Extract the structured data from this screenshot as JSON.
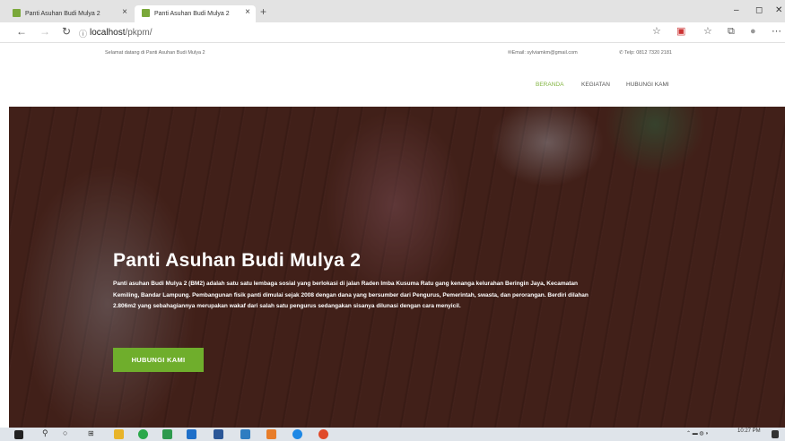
{
  "browser": {
    "tabs": [
      {
        "label": "Panti Asuhan Budi Mulya 2",
        "active": false
      },
      {
        "label": "Panti Asuhan Budi Mulya 2",
        "active": true
      }
    ],
    "new_tab": "+",
    "window_controls": {
      "minimize": "–",
      "maximize": "◻",
      "close": "✕"
    },
    "url_host": "localhost",
    "url_path": "/pkpm/"
  },
  "topinfo": {
    "welcome": "Selamat datang di Panti Asuhan Budi Mulya 2",
    "email": "Email: sylviamkm@gmail.com",
    "phone": "Telp: 0812 7320 2181"
  },
  "menu": {
    "items": [
      "BERANDA",
      "KEGIATAN",
      "HUBUNGI KAMI"
    ],
    "active_color": "#82b440"
  },
  "hero": {
    "title": "Panti Asuhan Budi Mulya 2",
    "text": "Panti asuhan Budi Mulya 2 (BM2) adalah satu satu lembaga sosial yang berlokasi di jalan Raden Imba Kusuma Ratu gang kenanga kelurahan Beringin Jaya, Kecamatan Kemiling, Bandar Lampung. Pembangunan fisik panti dimulai sejak 2008 dengan dana yang bersumber dari Pengurus, Pemerintah, swasta, dan perorangan. Berdiri dilahan 2.806m2 yang sebahagiannya merupakan wakaf dari salah satu pengurus sedangakan sisanya dilunasi dengan cara menyicil.",
    "button": "HUBUNGI KAMI",
    "button_color": "#6fae2c"
  },
  "taskbar": {
    "time": "10:27 PM"
  }
}
